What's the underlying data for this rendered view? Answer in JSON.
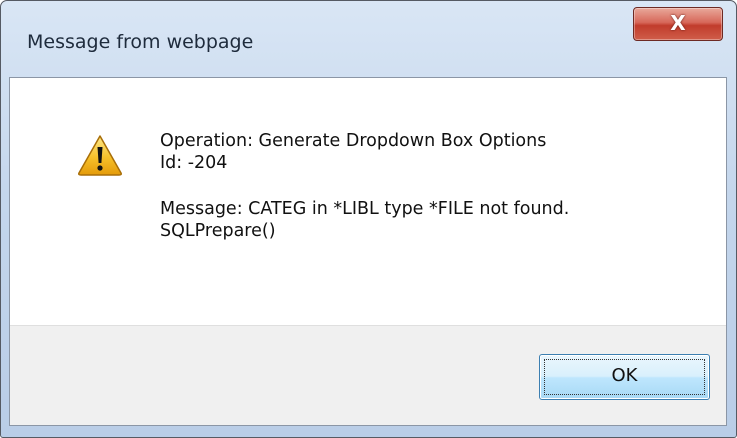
{
  "window": {
    "title": "Message from webpage",
    "close_symbol": "X"
  },
  "message": {
    "icon": "warning-icon",
    "line1": "Operation: Generate Dropdown Box Options",
    "line2": "Id: -204",
    "line3": "Message: CATEG in *LIBL type *FILE not found.",
    "line4": "SQLPrepare()"
  },
  "buttons": {
    "ok_label": "OK"
  },
  "colors": {
    "title_text": "#1e2b3c",
    "close_button": "#c13c2c",
    "warning_fill": "#f6c02a",
    "footer_bg": "#f0f0f0",
    "ok_border": "#3c7fb1"
  }
}
